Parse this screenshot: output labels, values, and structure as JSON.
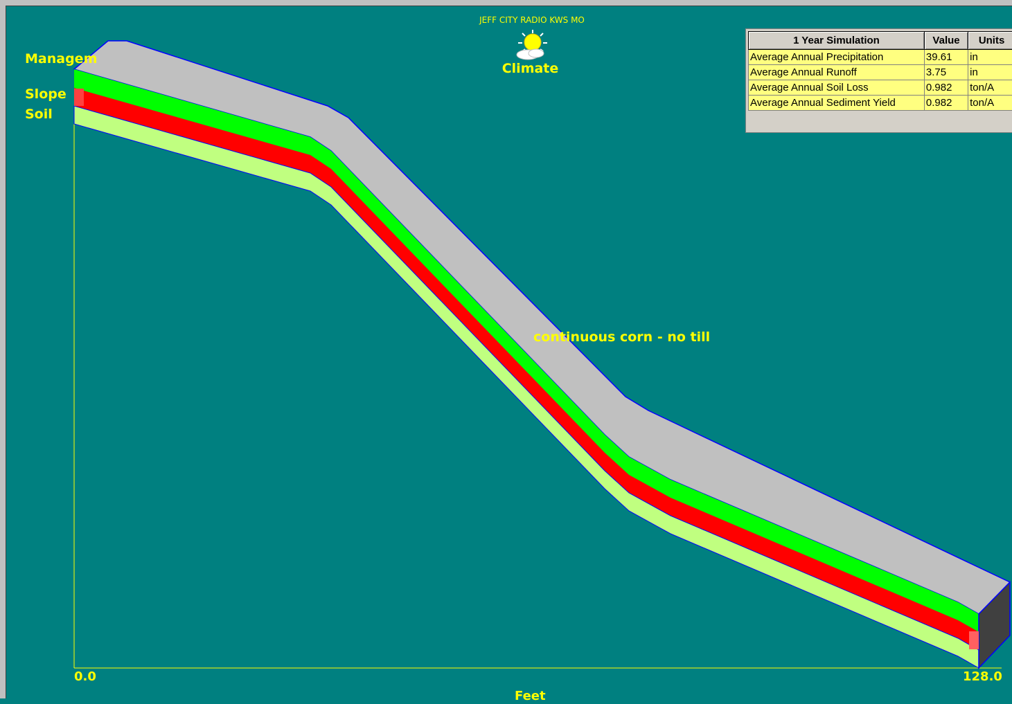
{
  "header": {
    "station": "JEFF CITY RADIO KWS MO",
    "climate_label": "Climate",
    "climate_icon": "sun-cloud-icon"
  },
  "layers": {
    "management_label": "Managem",
    "slope_label": "Slope",
    "soil_label": "Soil",
    "management_name": "continuous corn - no till"
  },
  "axis": {
    "x_start": "0.0",
    "x_end": "128.0",
    "x_label": "Feet"
  },
  "colors": {
    "background": "#008080",
    "management_layer": "#c0c0c0",
    "upper_layer": "#00ff00",
    "slope_layer": "#ff0000",
    "soil_layer": "#c0ff80",
    "end_face": "#404040",
    "label_text": "#ffff00"
  },
  "results": {
    "headers": [
      "1 Year Simulation",
      "Value",
      "Units"
    ],
    "rows": [
      {
        "label": "Average Annual Precipitation",
        "value": "39.61",
        "unit": "in"
      },
      {
        "label": "Average Annual Runoff",
        "value": "3.75",
        "unit": "in"
      },
      {
        "label": "Average Annual Soil Loss",
        "value": "0.982",
        "unit": "ton/A"
      },
      {
        "label": "Average Annual Sediment Yield",
        "value": "0.982",
        "unit": "ton/A"
      }
    ]
  }
}
